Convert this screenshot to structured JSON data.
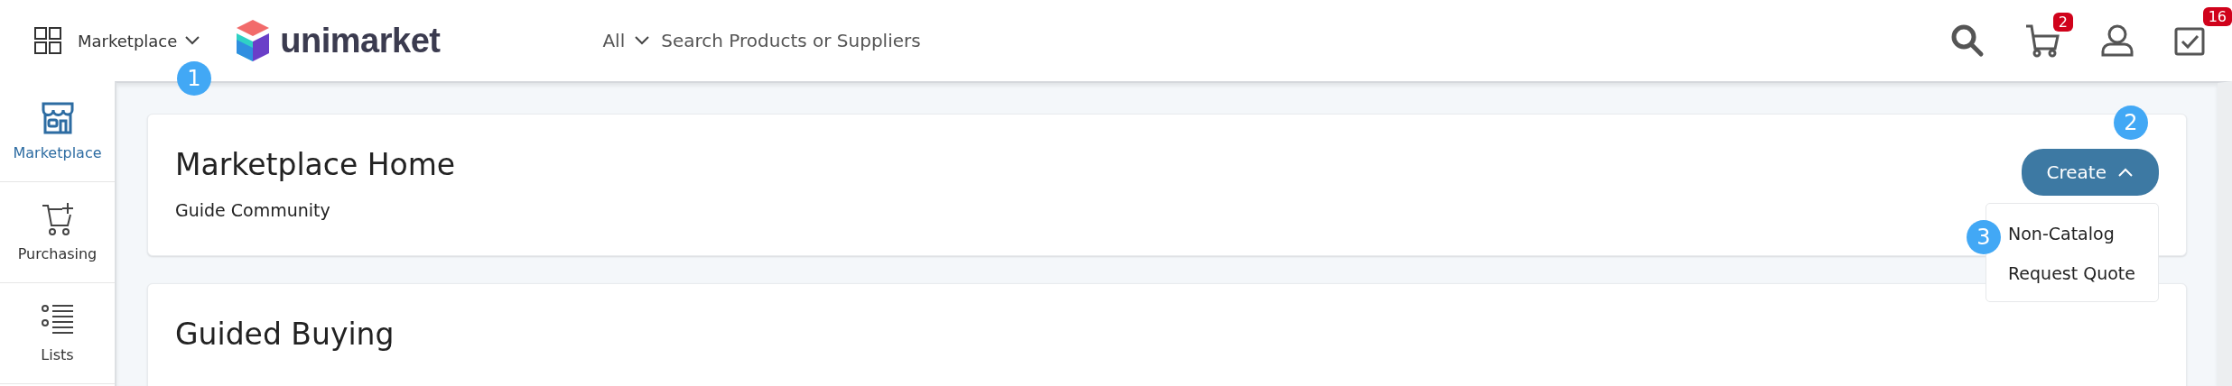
{
  "header": {
    "app_switcher": {
      "label": "Marketplace"
    },
    "logo": {
      "text": "unimarket"
    },
    "search": {
      "scope": "All",
      "placeholder": "Search Products or Suppliers"
    },
    "cart_badge": "2",
    "tasks_badge": "16"
  },
  "sidebar": {
    "items": [
      {
        "label": "Marketplace",
        "selected": true
      },
      {
        "label": "Purchasing",
        "selected": false
      },
      {
        "label": "Lists",
        "selected": false
      }
    ]
  },
  "cards": [
    {
      "title": "Marketplace Home",
      "subtitle": "Guide Community",
      "create_button": {
        "label": "Create",
        "expanded": true,
        "menu": [
          "Non-Catalog",
          "Request Quote"
        ]
      }
    },
    {
      "title": "Guided Buying"
    }
  ],
  "callouts": [
    "1",
    "2",
    "3"
  ]
}
